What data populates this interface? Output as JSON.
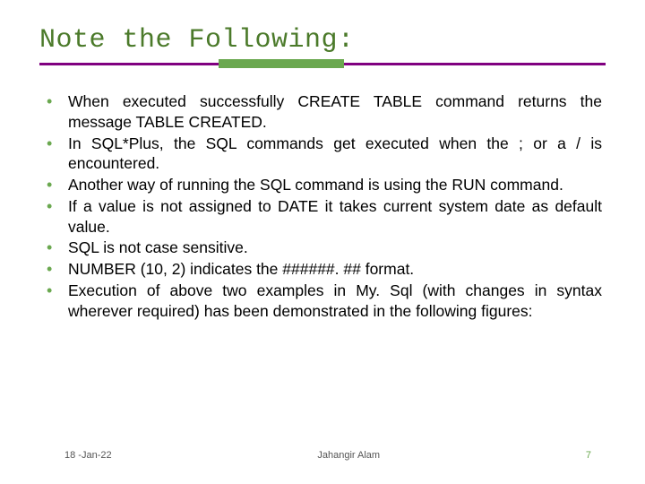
{
  "title": "Note the Following:",
  "bullets": [
    "When executed successfully CREATE TABLE command returns the message TABLE CREATED.",
    "In SQL*Plus, the SQL commands get executed when the ; or a / is encountered.",
    "Another way of running the SQL command is using the RUN command.",
    "If a value is not assigned to DATE it takes current system date as default value.",
    "SQL is not case sensitive.",
    "NUMBER (10, 2) indicates the ######. ## format.",
    "Execution of above two examples in My. Sql (with changes in syntax wherever required) has been demonstrated in the following figures:"
  ],
  "footer": {
    "date": "18 -Jan-22",
    "author": "Jahangir Alam",
    "page": "7"
  }
}
